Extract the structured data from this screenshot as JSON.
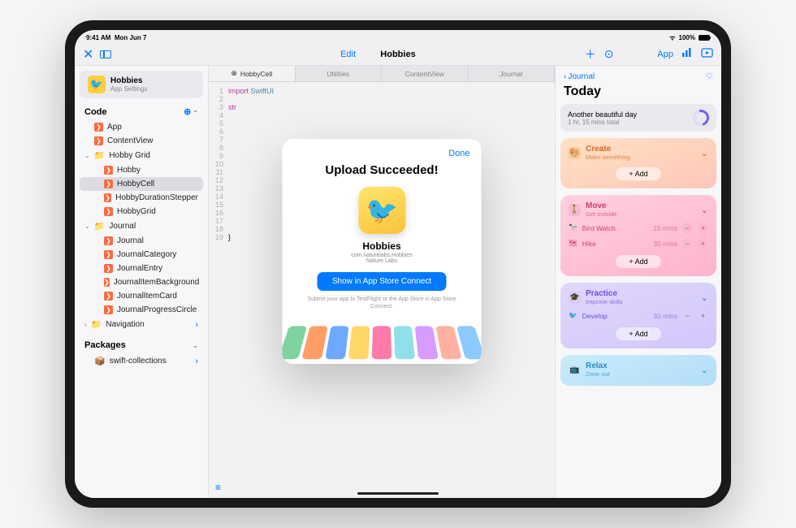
{
  "status": {
    "time": "9:41 AM",
    "date": "Mon Jun 7",
    "battery": "100%"
  },
  "toolbar": {
    "edit": "Edit",
    "title": "Hobbies",
    "app_label": "App"
  },
  "sidebar": {
    "project": {
      "name": "Hobbies",
      "sub": "App Settings"
    },
    "code_header": "Code",
    "packages_header": "Packages",
    "items": {
      "app": "App",
      "contentview": "ContentView",
      "hobbygrid_folder": "Hobby Grid",
      "hobby": "Hobby",
      "hobbycell": "HobbyCell",
      "hobbydur": "HobbyDurationStepper",
      "hobbygrid": "HobbyGrid",
      "journal_folder": "Journal",
      "journal": "Journal",
      "journalcat": "JournalCategory",
      "journalentry": "JournalEntry",
      "journalbg": "JournalItemBackground",
      "journalcard": "JournalItemCard",
      "journalprog": "JournalProgressCircle",
      "nav": "Navigation",
      "pkg": "swift-collections"
    }
  },
  "editor": {
    "tabs": [
      "HobbyCell",
      "Utilities",
      "ContentView",
      "Journal"
    ],
    "line_import": "import",
    "line_swiftui": "SwiftUI",
    "line_str": "str",
    "line_brace": "}"
  },
  "modal": {
    "done": "Done",
    "title": "Upload Succeeded!",
    "app": "Hobbies",
    "bundle": "com.naturelabs.Hobbies",
    "org": "Nature Labs",
    "button": "Show in App Store Connect",
    "hint": "Submit your app to TestFlight or the App Store in App Store Connect."
  },
  "preview": {
    "back": "Journal",
    "title": "Today",
    "summary": {
      "l1": "Another beautiful day",
      "l2": "1 hr, 15 mins total"
    },
    "create": {
      "title": "Create",
      "sub": "Make something",
      "add": "+ Add"
    },
    "move": {
      "title": "Move",
      "sub": "Get outside",
      "rows": [
        {
          "icon": "🔭",
          "label": "Bird Watch",
          "time": "15 mins"
        },
        {
          "icon": "🗺",
          "label": "Hike",
          "time": "30 mins"
        }
      ],
      "add": "+ Add"
    },
    "practice": {
      "title": "Practice",
      "sub": "Improve skills",
      "rows": [
        {
          "icon": "🐦",
          "label": "Develop",
          "time": "30 mins"
        }
      ],
      "add": "+ Add"
    },
    "relax": {
      "title": "Relax",
      "sub": "Zone out"
    }
  },
  "mosaic_colors": [
    "#7ed3a0",
    "#ff9d66",
    "#6fa8ff",
    "#ffd76a",
    "#ff7aa8",
    "#8fe0e8",
    "#d89bff",
    "#ffb0a0",
    "#8cc9ff"
  ]
}
